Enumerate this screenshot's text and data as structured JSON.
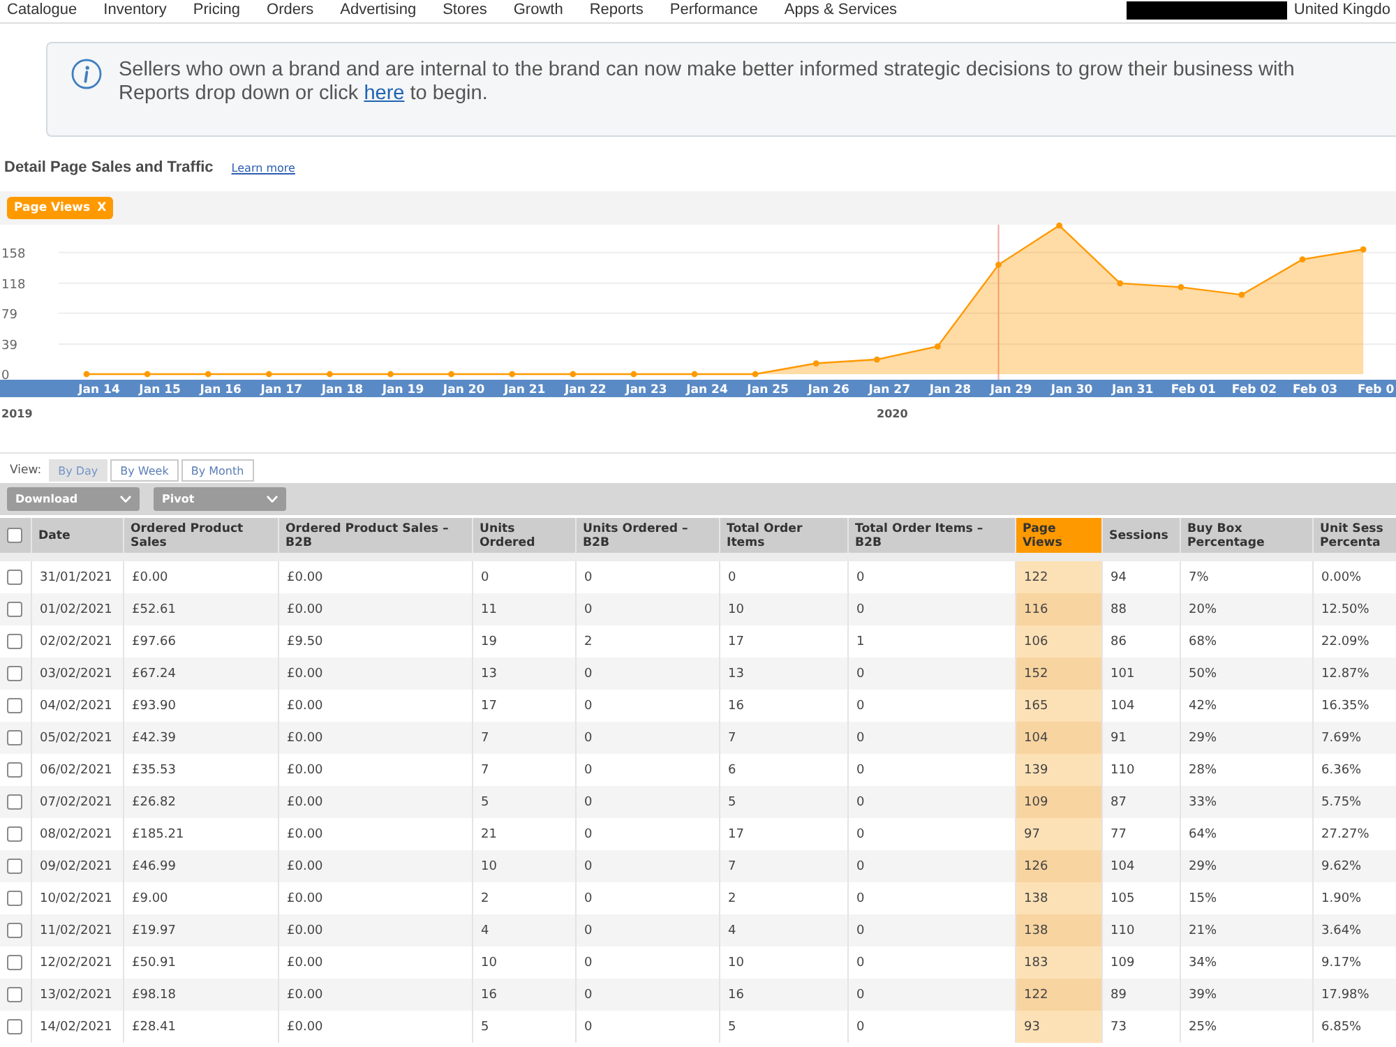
{
  "top_nav": {
    "items": [
      "Catalogue",
      "Inventory",
      "Pricing",
      "Orders",
      "Advertising",
      "Stores",
      "Growth",
      "Reports",
      "Performance",
      "Apps & Services"
    ],
    "region": "United Kingdo"
  },
  "banner": {
    "text": "Sellers who own a brand and are internal to the brand can now make better informed strategic decisions to grow their business with",
    "text_2": "Reports drop down or click ",
    "link": "here",
    "text_3": " to begin."
  },
  "report": {
    "title": "Detail Page Sales and Traffic",
    "learn_more": "Learn more"
  },
  "chart": {
    "remove_label": "X",
    "chart_data": {
      "type": "area",
      "categories": [
        "Jan 14",
        "Jan 15",
        "Jan 16",
        "Jan 17",
        "Jan 18",
        "Jan 19",
        "Jan 20",
        "Jan 21",
        "Jan 22",
        "Jan 23",
        "Jan 24",
        "Jan 25",
        "Jan 26",
        "Jan 27",
        "Jan 28",
        "Jan 29",
        "Jan 30",
        "Jan 31",
        "Feb 01",
        "Feb 02",
        "Feb 03",
        "Feb 0"
      ],
      "series": [
        {
          "name": "Page Views",
          "color": "#ff9900",
          "values": [
            0,
            0,
            0,
            0,
            0,
            0,
            0,
            0,
            0,
            0,
            0,
            0,
            14,
            19,
            36,
            142,
            193,
            118,
            113,
            103,
            149,
            162
          ]
        }
      ],
      "ylim": [
        0,
        194
      ],
      "yticks": [
        0,
        39,
        79,
        118,
        158
      ],
      "grid": true,
      "ref_lines": [
        {
          "axis": "x",
          "value": "Jan 29"
        }
      ]
    },
    "year_labels": [
      "2019",
      "2020"
    ]
  },
  "view": {
    "label": "View:",
    "tabs": [
      {
        "label": "By Day",
        "selected": true
      },
      {
        "label": "By Week",
        "selected": false
      },
      {
        "label": "By Month",
        "selected": false
      }
    ]
  },
  "toolbar": {
    "dropdowns": [
      "Download",
      "Pivot"
    ]
  },
  "table": {
    "select_all_checked": false,
    "columns": [
      {
        "label": "Date",
        "selected": false
      },
      {
        "label": "Ordered Product Sales",
        "selected": false
      },
      {
        "label": "Ordered Product Sales – B2B",
        "selected": false
      },
      {
        "label": "Units Ordered",
        "selected": false
      },
      {
        "label": "Units Ordered – B2B",
        "selected": false
      },
      {
        "label": "Total Order Items",
        "selected": false
      },
      {
        "label": "Total Order Items – B2B",
        "selected": false
      },
      {
        "label": "Page Views",
        "selected": true
      },
      {
        "label": "Sessions",
        "selected": false
      },
      {
        "label": "Buy Box Percentage",
        "selected": false
      },
      {
        "label": "Unit Sess Percenta",
        "selected": false
      }
    ],
    "rows": [
      {
        "checked": false,
        "cells": [
          "31/01/2021",
          "£0.00",
          "£0.00",
          "0",
          "0",
          "0",
          "0",
          "122",
          "94",
          "7%",
          "0.00%"
        ]
      },
      {
        "checked": false,
        "cells": [
          "01/02/2021",
          "£52.61",
          "£0.00",
          "11",
          "0",
          "10",
          "0",
          "116",
          "88",
          "20%",
          "12.50%"
        ]
      },
      {
        "checked": false,
        "cells": [
          "02/02/2021",
          "£97.66",
          "£9.50",
          "19",
          "2",
          "17",
          "1",
          "106",
          "86",
          "68%",
          "22.09%"
        ]
      },
      {
        "checked": false,
        "cells": [
          "03/02/2021",
          "£67.24",
          "£0.00",
          "13",
          "0",
          "13",
          "0",
          "152",
          "101",
          "50%",
          "12.87%"
        ]
      },
      {
        "checked": false,
        "cells": [
          "04/02/2021",
          "£93.90",
          "£0.00",
          "17",
          "0",
          "16",
          "0",
          "165",
          "104",
          "42%",
          "16.35%"
        ]
      },
      {
        "checked": false,
        "cells": [
          "05/02/2021",
          "£42.39",
          "£0.00",
          "7",
          "0",
          "7",
          "0",
          "104",
          "91",
          "29%",
          "7.69%"
        ]
      },
      {
        "checked": false,
        "cells": [
          "06/02/2021",
          "£35.53",
          "£0.00",
          "7",
          "0",
          "6",
          "0",
          "139",
          "110",
          "28%",
          "6.36%"
        ]
      },
      {
        "checked": false,
        "cells": [
          "07/02/2021",
          "£26.82",
          "£0.00",
          "5",
          "0",
          "5",
          "0",
          "109",
          "87",
          "33%",
          "5.75%"
        ]
      },
      {
        "checked": false,
        "cells": [
          "08/02/2021",
          "£185.21",
          "£0.00",
          "21",
          "0",
          "17",
          "0",
          "97",
          "77",
          "64%",
          "27.27%"
        ]
      },
      {
        "checked": false,
        "cells": [
          "09/02/2021",
          "£46.99",
          "£0.00",
          "10",
          "0",
          "7",
          "0",
          "126",
          "104",
          "29%",
          "9.62%"
        ]
      },
      {
        "checked": false,
        "cells": [
          "10/02/2021",
          "£9.00",
          "£0.00",
          "2",
          "0",
          "2",
          "0",
          "138",
          "105",
          "15%",
          "1.90%"
        ]
      },
      {
        "checked": false,
        "cells": [
          "11/02/2021",
          "£19.97",
          "£0.00",
          "4",
          "0",
          "4",
          "0",
          "138",
          "110",
          "21%",
          "3.64%"
        ]
      },
      {
        "checked": false,
        "cells": [
          "12/02/2021",
          "£50.91",
          "£0.00",
          "10",
          "0",
          "10",
          "0",
          "183",
          "109",
          "34%",
          "9.17%"
        ]
      },
      {
        "checked": false,
        "cells": [
          "13/02/2021",
          "£98.18",
          "£0.00",
          "16",
          "0",
          "16",
          "0",
          "122",
          "89",
          "39%",
          "17.98%"
        ]
      },
      {
        "checked": false,
        "cells": [
          "14/02/2021",
          "£28.41",
          "£0.00",
          "5",
          "0",
          "5",
          "0",
          "93",
          "73",
          "25%",
          "6.85%"
        ]
      }
    ]
  }
}
